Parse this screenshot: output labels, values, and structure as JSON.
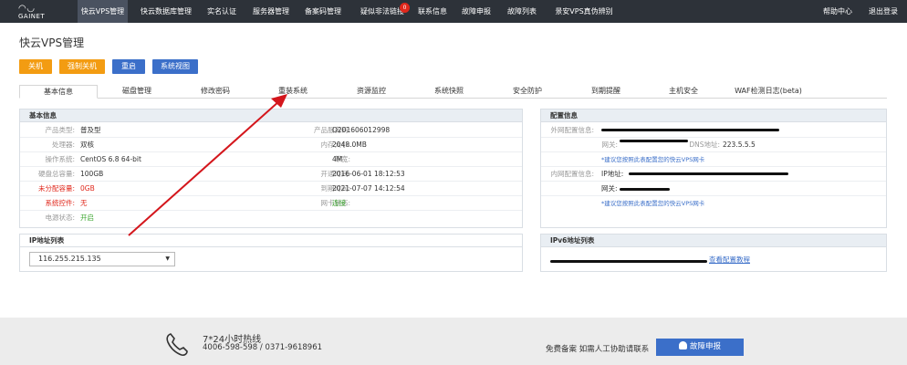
{
  "nav": {
    "logo": "GAINET",
    "items": [
      "快云VPS管理",
      "快云数据库管理",
      "实名认证",
      "服务器管理",
      "备案码管理",
      "疑似非法链接",
      "联系信息",
      "故障申报",
      "故障列表",
      "景安VPS真伪辨别"
    ],
    "badge": "0",
    "right": [
      "帮助中心",
      "退出登录"
    ]
  },
  "page": {
    "title": "快云VPS管理"
  },
  "actions": [
    "关机",
    "强制关机",
    "重启",
    "系统视图"
  ],
  "tabs": [
    "基本信息",
    "磁盘管理",
    "修改密码",
    "重装系统",
    "资源监控",
    "系统快照",
    "安全防护",
    "到期提醒",
    "主机安全",
    "WAF检测日志(beta)"
  ],
  "basic_info": {
    "title": "基本信息",
    "left": [
      {
        "label": "产品类型:",
        "value": "普及型"
      },
      {
        "label": "处理器:",
        "value": "双核"
      },
      {
        "label": "操作系统:",
        "value": "CentOS 6.8 64-bit"
      },
      {
        "label": "硬盘总容量:",
        "value": "100GB"
      },
      {
        "label": "未分配容量:",
        "value": "0GB"
      },
      {
        "label": "系统控件:",
        "value": "无"
      },
      {
        "label": "电源状态:",
        "value": "开启"
      }
    ],
    "right": [
      {
        "label": "产品服务码:",
        "value": "O201606012998"
      },
      {
        "label": "内存大小:",
        "value": "2048.0MB"
      },
      {
        "label": "带宽:",
        "value": "4M"
      },
      {
        "label": "开通时间:",
        "value": "2016-06-01 18:12:53"
      },
      {
        "label": "到期时间:",
        "value": "2021-07-07 14:12:54"
      },
      {
        "label": "网卡状态:",
        "value": "连接"
      }
    ]
  },
  "config_info": {
    "title": "配置信息",
    "external_label": "外网配置信息:",
    "gateway_label": "网关:",
    "dns_label": "DNS地址:",
    "dns_value": "223.5.5.5",
    "note1": "*建议您按照此表配置您的快云VPS网卡",
    "internal_label": "内网配置信息:",
    "ip_label": "IP地址:",
    "gateway2_label": "网关:",
    "note2": "*建议您按照此表配置您的快云VPS网卡"
  },
  "ip_list": {
    "title": "IP地址列表",
    "selected": "116.255.215.135"
  },
  "ipv6_list": {
    "title": "IPv6地址列表",
    "link": "查看配置教程"
  },
  "footer": {
    "hotline_title": "7*24小时热线",
    "hotline_numbers": "4006-598-598 / 0371-9618961",
    "beian": "免费备案 如需人工协助请联系",
    "fault_button": "故障申报"
  }
}
